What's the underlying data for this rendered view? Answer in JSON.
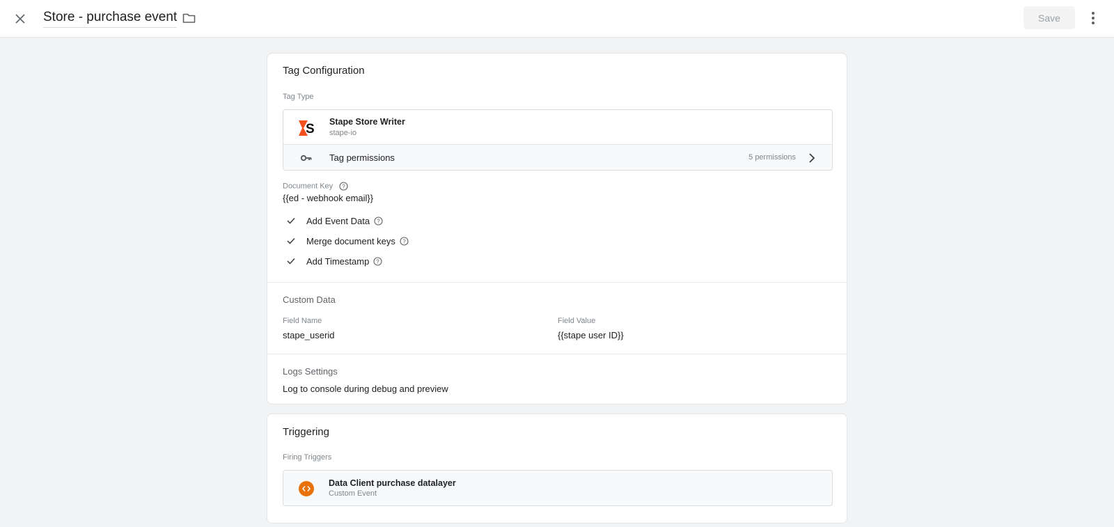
{
  "header": {
    "title": "Store - purchase event",
    "save_label": "Save",
    "icons": {
      "close": "close-icon",
      "folder": "folder-icon",
      "more": "more-vert-icon"
    }
  },
  "tag_configuration": {
    "title": "Tag Configuration",
    "tag_type_label": "Tag Type",
    "tag_type": {
      "name": "Stape Store Writer",
      "publisher": "stape-io",
      "logo": "stape-logo",
      "brand_color": "#f4511e"
    },
    "permissions": {
      "label": "Tag permissions",
      "count": "5 permissions",
      "icon": "key-icon"
    },
    "document_key": {
      "label": "Document Key",
      "value": "{{ed - webhook email}}"
    },
    "options": [
      {
        "label": "Add Event Data",
        "checked": true
      },
      {
        "label": "Merge document keys",
        "checked": true
      },
      {
        "label": "Add Timestamp",
        "checked": true
      }
    ],
    "custom_data": {
      "title": "Custom Data",
      "columns": [
        "Field Name",
        "Field Value"
      ],
      "rows": [
        {
          "name": "stape_userid",
          "value": "{{stape user ID}}"
        }
      ]
    },
    "logs_settings": {
      "title": "Logs Settings",
      "value": "Log to console during debug and preview"
    }
  },
  "triggering": {
    "title": "Triggering",
    "firing_label": "Firing Triggers",
    "triggers": [
      {
        "name": "Data Client purchase datalayer",
        "type": "Custom Event",
        "icon": "custom-event-icon",
        "color": "#e8710a"
      }
    ]
  }
}
